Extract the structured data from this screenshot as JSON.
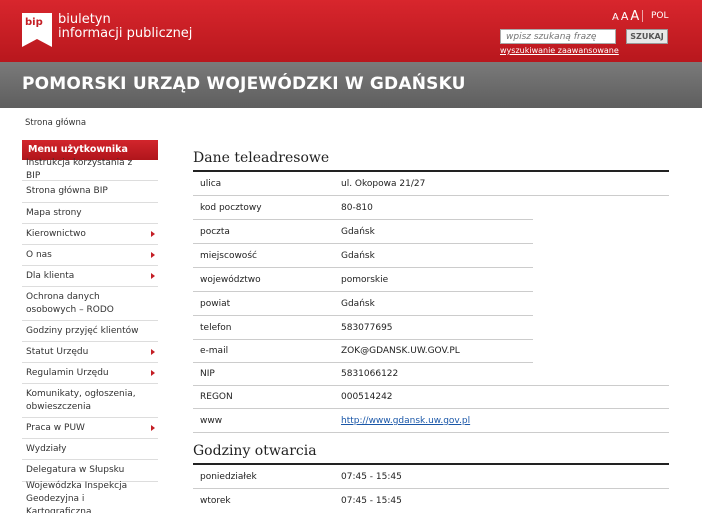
{
  "header": {
    "logo_mark": "bip",
    "logo_line1": "biuletyn",
    "logo_line2": "informacji publicznej",
    "font_size_labels": [
      "A",
      "A",
      "A"
    ],
    "language": "POL",
    "search_placeholder": "wpisz szukaną frazę",
    "search_button": "SZUKAJ",
    "advanced_search": "wyszukiwanie zaawansowane"
  },
  "banner": {
    "title": "POMORSKI URZĄD WOJEWÓDZKI W GDAŃSKU"
  },
  "breadcrumb": "Strona główna",
  "sidebar": {
    "title": "Menu użytkownika",
    "items": [
      {
        "label": "Instrukcja korzystania z BIP",
        "arrow": false
      },
      {
        "label": "Strona główna BIP",
        "arrow": false
      },
      {
        "label": "Mapa strony",
        "arrow": false
      },
      {
        "label": "Kierownictwo",
        "arrow": true
      },
      {
        "label": "O nas",
        "arrow": true
      },
      {
        "label": "Dla klienta",
        "arrow": true
      },
      {
        "label": "Ochrona danych osobowych – RODO",
        "arrow": false
      },
      {
        "label": "Godziny przyjęć klientów",
        "arrow": false
      },
      {
        "label": "Statut Urzędu",
        "arrow": true
      },
      {
        "label": "Regulamin Urzędu",
        "arrow": true
      },
      {
        "label": "Komunikaty, ogłoszenia, obwieszczenia",
        "arrow": false
      },
      {
        "label": "Praca w PUW",
        "arrow": true
      },
      {
        "label": "Wydziały",
        "arrow": false
      },
      {
        "label": "Delegatura w Słupsku",
        "arrow": false
      },
      {
        "label": "Wojewódzka Inspekcja Geodezyjna i Kartograficzna",
        "arrow": false
      }
    ]
  },
  "contact": {
    "title": "Dane teleadresowe",
    "rows": [
      {
        "label": "ulica",
        "value": "ul. Okopowa 21/27"
      },
      {
        "label": "kod pocztowy",
        "value": "80-810"
      },
      {
        "label": "poczta",
        "value": "Gdańsk"
      },
      {
        "label": "miejscowość",
        "value": "Gdańsk"
      },
      {
        "label": "województwo",
        "value": "pomorskie"
      },
      {
        "label": "powiat",
        "value": "Gdańsk"
      },
      {
        "label": "telefon",
        "value": "583077695"
      },
      {
        "label": "e-mail",
        "value": "ZOK@GDANSK.UW.GOV.PL"
      },
      {
        "label": "NIP",
        "value": "5831066122"
      },
      {
        "label": "REGON",
        "value": "000514242"
      },
      {
        "label": "www",
        "value": "http://www.gdansk.uw.gov.pl"
      }
    ]
  },
  "hours": {
    "title": "Godziny otwarcia",
    "rows": [
      {
        "label": "poniedziałek",
        "value": "07:45 - 15:45"
      },
      {
        "label": "wtorek",
        "value": "07:45 - 15:45"
      }
    ]
  }
}
